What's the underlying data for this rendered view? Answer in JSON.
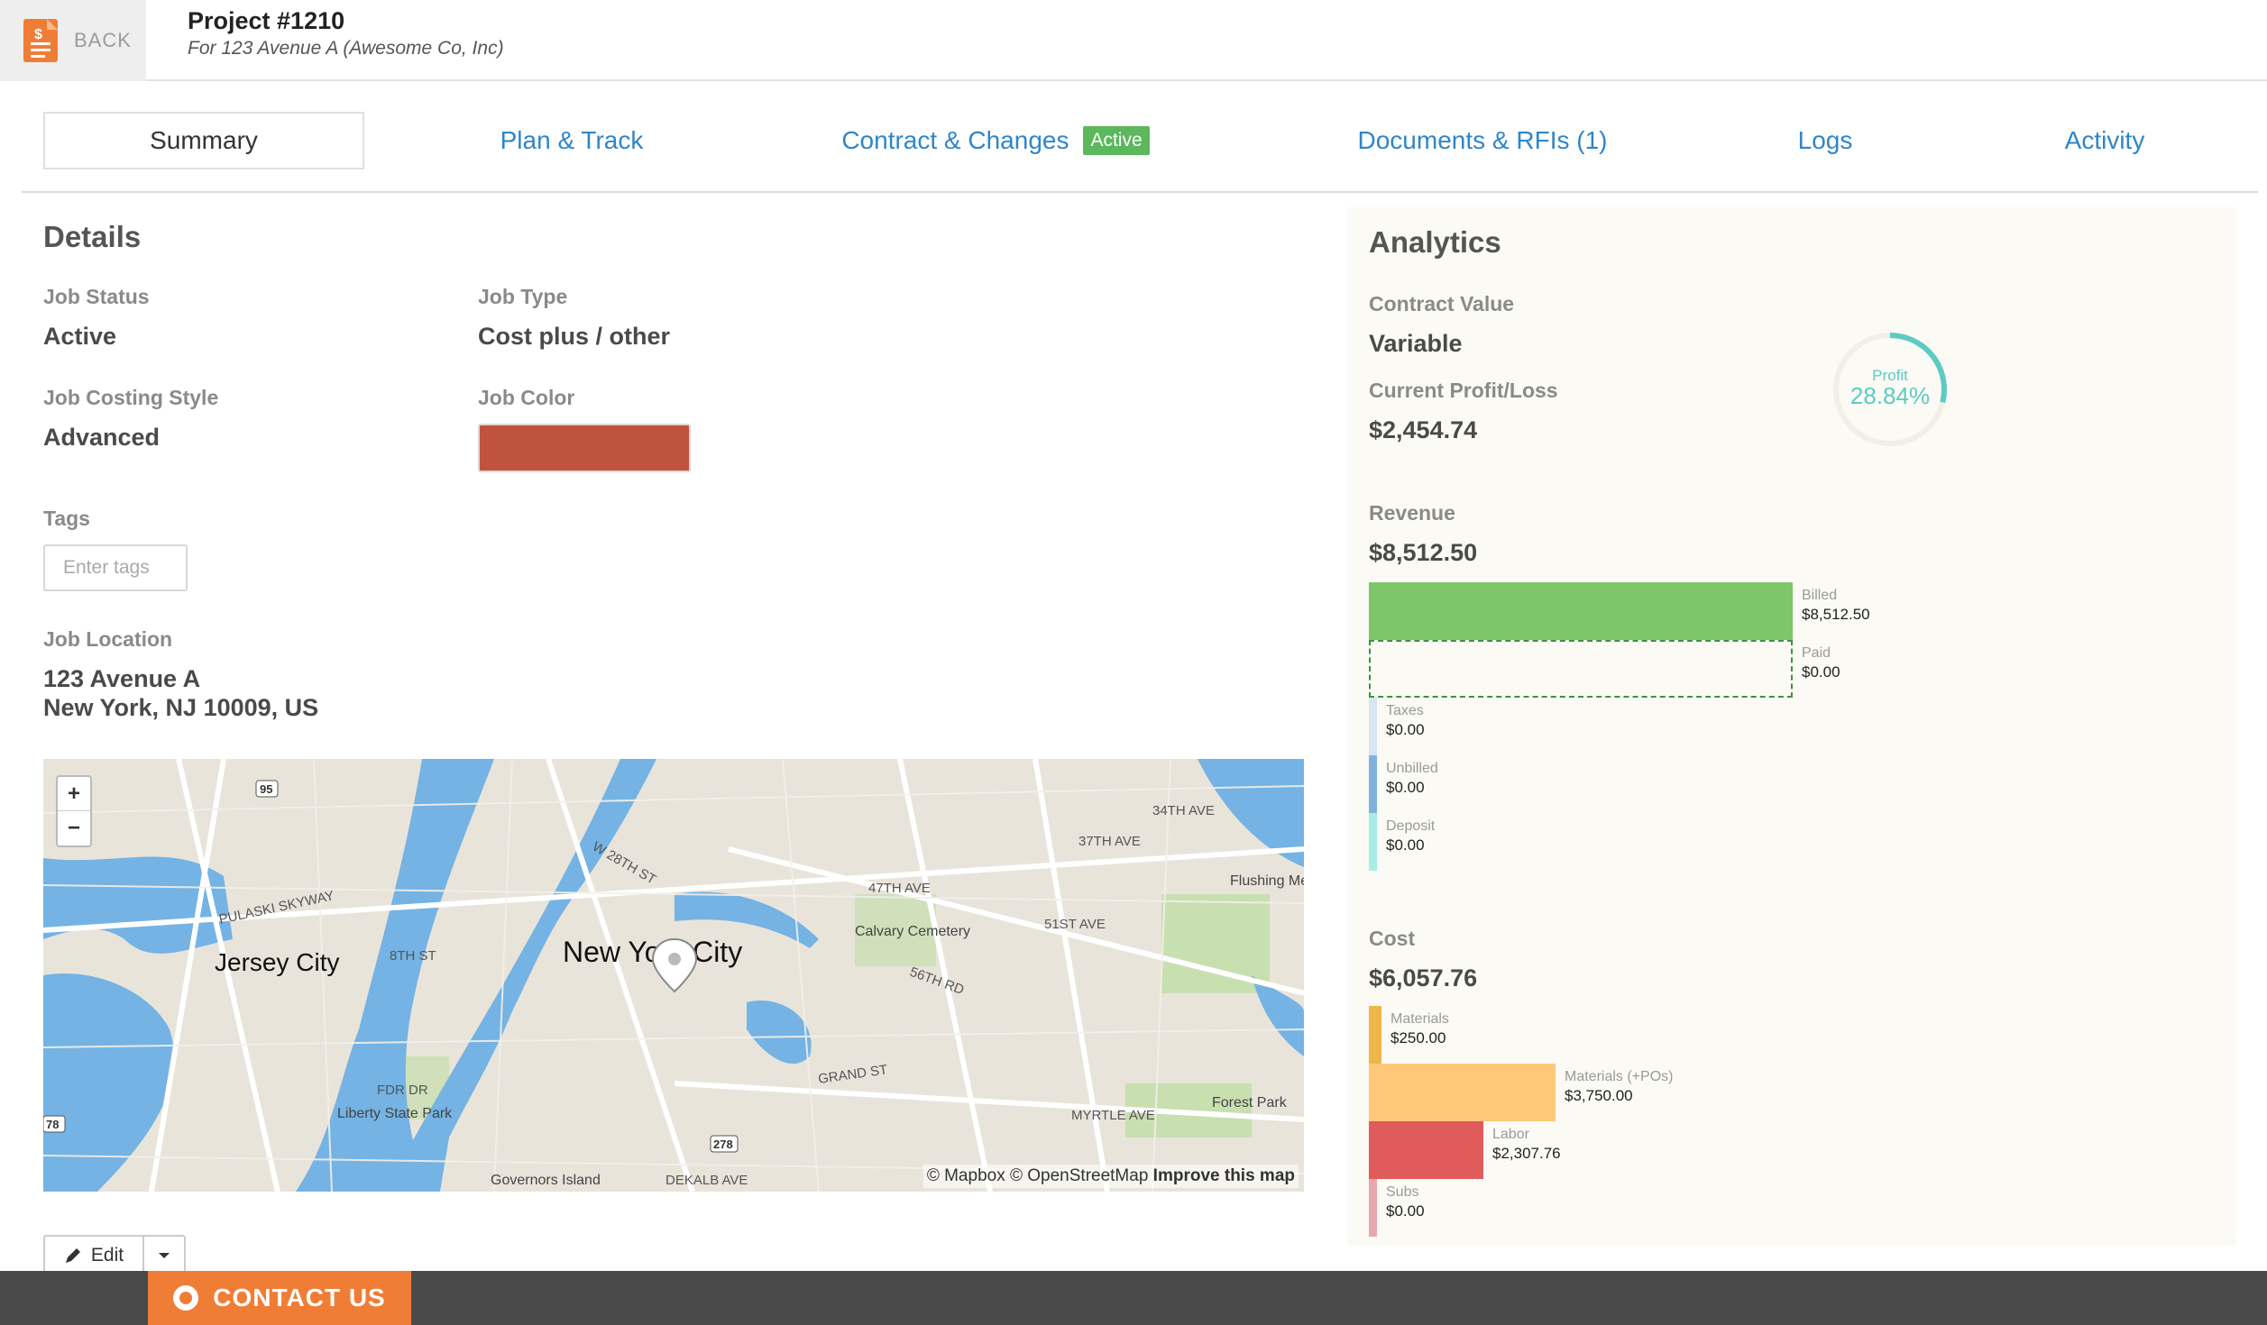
{
  "header": {
    "back_label": "BACK",
    "project_title": "Project #1210",
    "project_subtitle": "For 123 Avenue A (Awesome Co, Inc)"
  },
  "tabs": [
    {
      "label": "Summary"
    },
    {
      "label": "Plan & Track"
    },
    {
      "label": "Contract & Changes",
      "badge": "Active"
    },
    {
      "label": "Documents & RFIs (1)"
    },
    {
      "label": "Logs"
    },
    {
      "label": "Activity"
    }
  ],
  "details": {
    "title": "Details",
    "job_status_label": "Job Status",
    "job_status": "Active",
    "job_type_label": "Job Type",
    "job_type": "Cost plus / other",
    "costing_style_label": "Job Costing Style",
    "costing_style": "Advanced",
    "job_color_label": "Job Color",
    "job_color": "#c0533d",
    "tags_label": "Tags",
    "tags_placeholder": "Enter tags",
    "location_label": "Job Location",
    "address_line1": "123 Avenue A",
    "address_line2": "New York, NJ 10009, US"
  },
  "map": {
    "zoom_in": "+",
    "zoom_out": "−",
    "labels": {
      "jersey_city": "Jersey City",
      "new_york_city": "New York City",
      "calvary": "Calvary Cemetery",
      "flushing": "Flushing Meadows-Corona Park",
      "forest_park": "Forest Park",
      "liberty": "Liberty State Park",
      "governors": "Governors Island",
      "pulaski": "PULASKI SKYWAY",
      "fdr": "FDR DR",
      "grand": "GRAND ST",
      "myrtle": "MYRTLE AVE",
      "dekalb": "DEKALB AVE",
      "st47": "47TH AVE",
      "st51": "51ST AVE",
      "st56": "56TH RD",
      "ave37": "37TH AVE",
      "st34": "34TH AVE",
      "st8": "8TH ST",
      "w28": "W 28TH ST",
      "shield95": "95",
      "shield278": "278",
      "shield78": "78"
    },
    "attribution": "© Mapbox © OpenStreetMap",
    "improve": "Improve this map"
  },
  "edit_label": "Edit",
  "contact_label": "CONTACT US",
  "analytics": {
    "title": "Analytics",
    "contract_value_label": "Contract Value",
    "contract_value": "Variable",
    "profit_loss_label": "Current Profit/Loss",
    "profit_loss": "$2,454.74",
    "profit_label": "Profit",
    "profit_pct_text": "28.84%",
    "profit_pct": 28.84,
    "revenue_label": "Revenue",
    "revenue": "$8,512.50",
    "revenue_items": [
      {
        "label": "Billed",
        "value_text": "$8,512.50",
        "value": 8512.5,
        "color": "#7ec66a"
      },
      {
        "label": "Paid",
        "value_text": "$0.00",
        "value": 0,
        "color": "#3d9140"
      },
      {
        "label": "Taxes",
        "value_text": "$0.00",
        "value": 0,
        "color": "#d6e6f5"
      },
      {
        "label": "Unbilled",
        "value_text": "$0.00",
        "value": 0,
        "color": "#7fb3dc"
      },
      {
        "label": "Deposit",
        "value_text": "$0.00",
        "value": 0,
        "color": "#a6ede6"
      }
    ],
    "cost_label": "Cost",
    "cost": "$6,057.76",
    "cost_items": [
      {
        "label": "Materials",
        "value_text": "$250.00",
        "value": 250.0,
        "color": "#f0b64a"
      },
      {
        "label": "Materials (+POs)",
        "value_text": "$3,750.00",
        "value": 3750.0,
        "color": "#fec878"
      },
      {
        "label": "Labor",
        "value_text": "$2,307.76",
        "value": 2307.76,
        "color": "#e05b5b"
      },
      {
        "label": "Subs",
        "value_text": "$0.00",
        "value": 0,
        "color": "#e6a7ae"
      }
    ]
  }
}
